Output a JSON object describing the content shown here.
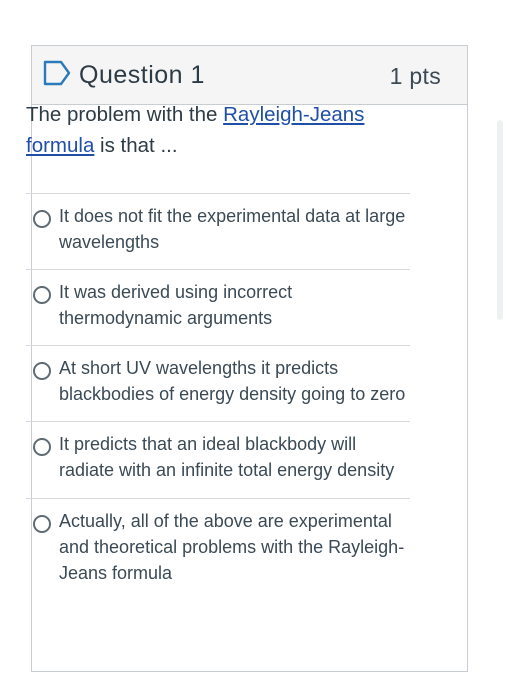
{
  "question": {
    "title": "Question 1",
    "points": "1 pts",
    "text_before": "The problem with the ",
    "link_text": "Rayleigh-Jeans formula",
    "text_after": " is that ..."
  },
  "answers": [
    {
      "label": "It does not fit the experimental data at large wavelengths"
    },
    {
      "label": "It was derived using incorrect thermodynamic arguments"
    },
    {
      "label": "At short UV wavelengths it predicts blackbodies of energy density going to zero"
    },
    {
      "label": "It predicts that an ideal blackbody will radiate with an infinite total energy density"
    },
    {
      "label": "Actually, all of the above are experimental and theoretical problems with the Rayleigh-Jeans formula"
    }
  ],
  "colors": {
    "link": "#1f4fa8",
    "flag": "#2b7abc",
    "header_bg": "#f5f5f5",
    "border": "#c7cdd1"
  },
  "icons": {
    "flag": "bookmark-flag-icon",
    "radio": "radio-unchecked-icon"
  }
}
